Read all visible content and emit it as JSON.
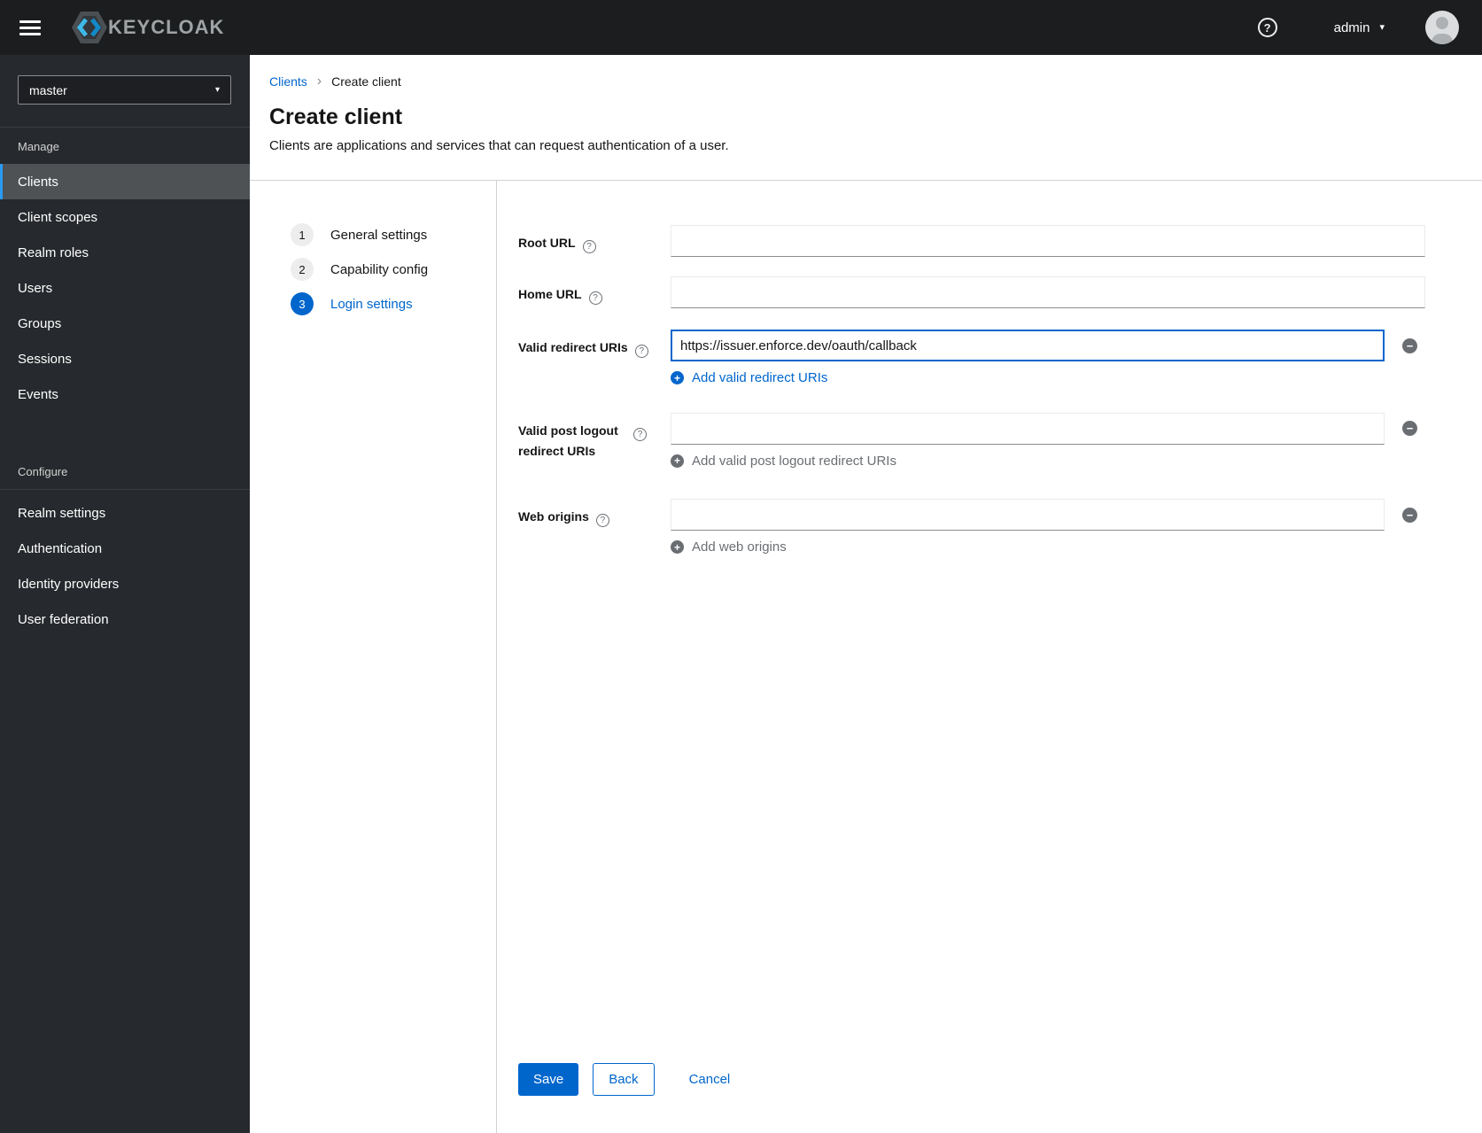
{
  "masthead": {
    "brand": "KEYCLOAK",
    "username": "admin"
  },
  "sidebar": {
    "realm": "master",
    "sections": [
      {
        "title": "Manage",
        "items": [
          {
            "label": "Clients",
            "selected": true
          },
          {
            "label": "Client scopes"
          },
          {
            "label": "Realm roles"
          },
          {
            "label": "Users"
          },
          {
            "label": "Groups"
          },
          {
            "label": "Sessions"
          },
          {
            "label": "Events"
          }
        ]
      },
      {
        "title": "Configure",
        "items": [
          {
            "label": "Realm settings"
          },
          {
            "label": "Authentication"
          },
          {
            "label": "Identity providers"
          },
          {
            "label": "User federation"
          }
        ]
      }
    ]
  },
  "breadcrumb": {
    "parent": "Clients",
    "current": "Create client"
  },
  "page": {
    "title": "Create client",
    "subtitle": "Clients are applications and services that can request authentication of a user."
  },
  "wizard": {
    "steps": [
      {
        "number": "1",
        "label": "General settings",
        "active": false
      },
      {
        "number": "2",
        "label": "Capability config",
        "active": false
      },
      {
        "number": "3",
        "label": "Login settings",
        "active": true
      }
    ]
  },
  "form": {
    "root_url": {
      "label": "Root URL",
      "value": ""
    },
    "home_url": {
      "label": "Home URL",
      "value": ""
    },
    "valid_redirect_uris": {
      "label": "Valid redirect URIs",
      "value": "https://issuer.enforce.dev/oauth/callback",
      "add_label": "Add valid redirect URIs"
    },
    "post_logout_uris": {
      "label": "Valid post logout redirect URIs",
      "value": "",
      "add_label": "Add valid post logout redirect URIs"
    },
    "web_origins": {
      "label": "Web origins",
      "value": "",
      "add_label": "Add web origins"
    }
  },
  "actions": {
    "save": "Save",
    "back": "Back",
    "cancel": "Cancel"
  },
  "icons": {
    "plus": "+",
    "minus": "−",
    "help": "?",
    "caret_down": "▾",
    "breadcrumb_chevron": "›"
  },
  "colors": {
    "primary": "#0066cc",
    "masthead_bg": "#1b1d1e",
    "sidebar_bg": "#26292d",
    "selected_item_bg": "#4f5255",
    "selected_item_accent": "#2b9af3",
    "disabled_text": "#6a6e73"
  }
}
